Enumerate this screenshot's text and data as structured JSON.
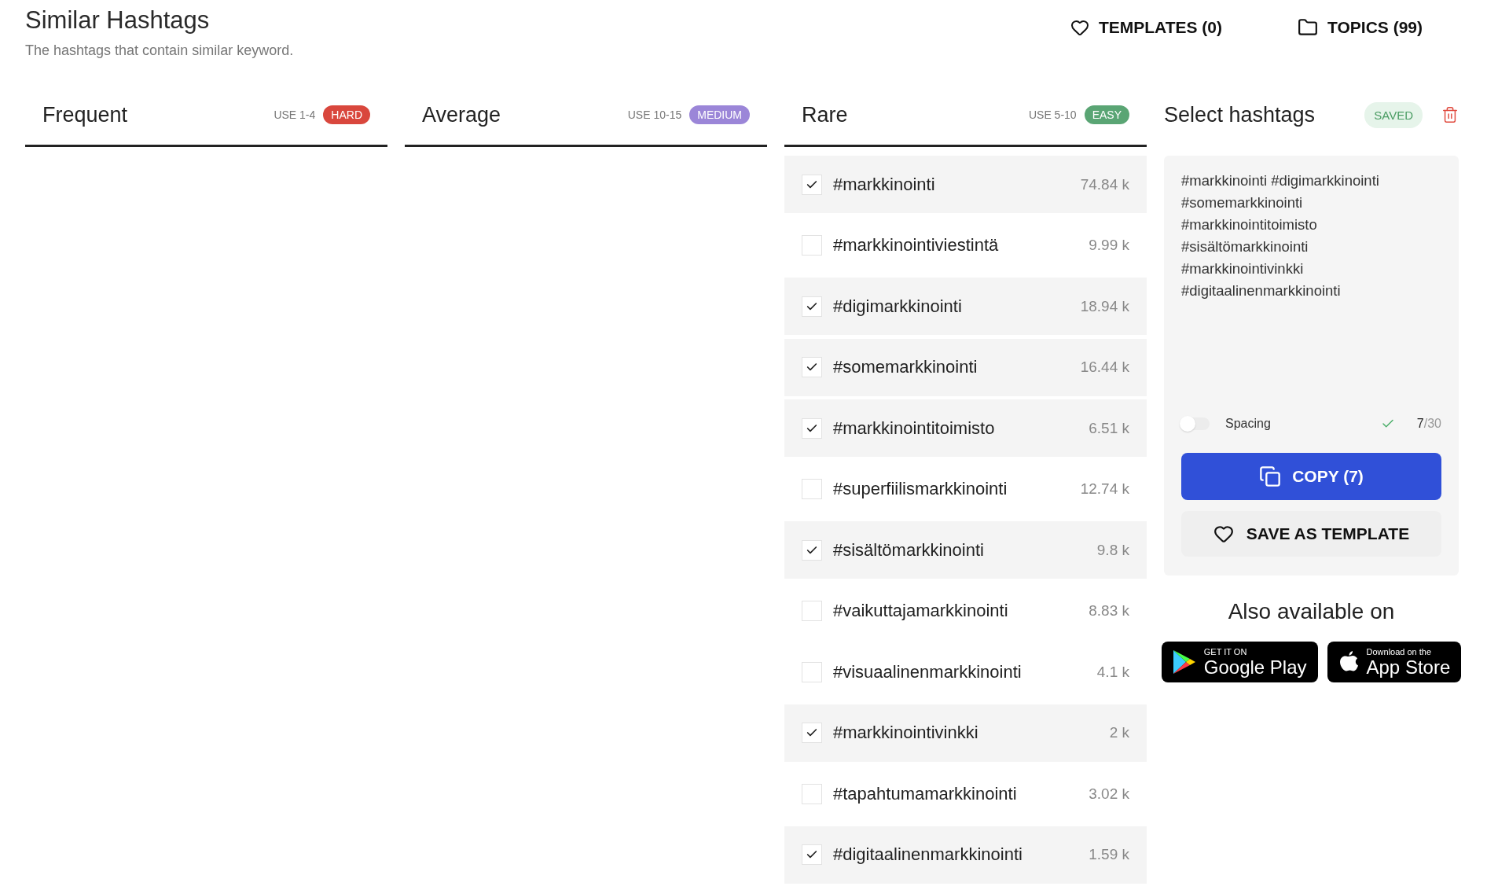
{
  "header": {
    "title": "Similar Hashtags",
    "subtitle": "The hashtags that contain similar keyword.",
    "actions": [
      {
        "kind": "heart",
        "label": "TEMPLATES (0)"
      },
      {
        "kind": "folder",
        "label": "TOPICS (99)"
      }
    ]
  },
  "columns": [
    {
      "title": "Frequent",
      "use": "USE 1-4",
      "badge": "HARD",
      "color": "#d9473d"
    },
    {
      "title": "Average",
      "use": "USE 10-15",
      "badge": "MEDIUM",
      "color": "#9b86d8"
    },
    {
      "title": "Rare",
      "use": "USE 5-10",
      "badge": "EASY",
      "color": "#5aa574",
      "hashtags": [
        {
          "tag": "#markkinointi",
          "count": "74.84 k",
          "checked": true
        },
        {
          "tag": "#markkinointiviestintä",
          "count": "9.99 k",
          "checked": false
        },
        {
          "tag": "#digimarkkinointi",
          "count": "18.94 k",
          "checked": true
        },
        {
          "tag": "#somemarkkinointi",
          "count": "16.44 k",
          "checked": true
        },
        {
          "tag": "#markkinointitoimisto",
          "count": "6.51 k",
          "checked": true
        },
        {
          "tag": "#superfiilismarkkinointi",
          "count": "12.74 k",
          "checked": false
        },
        {
          "tag": "#sisältömarkkinointi",
          "count": "9.8 k",
          "checked": true
        },
        {
          "tag": "#vaikuttajamarkkinointi",
          "count": "8.83 k",
          "checked": false
        },
        {
          "tag": "#visuaalinenmarkkinointi",
          "count": "4.1 k",
          "checked": false
        },
        {
          "tag": "#markkinointivinkki",
          "count": "2 k",
          "checked": true
        },
        {
          "tag": "#tapahtumamarkkinointi",
          "count": "3.02 k",
          "checked": false
        },
        {
          "tag": "#digitaalinenmarkkinointi",
          "count": "1.59 k",
          "checked": true
        }
      ]
    }
  ],
  "selection": {
    "title": "Select hashtags",
    "status": "SAVED",
    "text": "#markkinointi #digimarkkinointi #somemarkkinointi #markkinointitoimisto #sisältömarkkinointi #markkinointivinkki #digitaalinenmarkkinointi",
    "spacing": {
      "label": "Spacing",
      "on": false
    },
    "count": "7",
    "limit": "/30",
    "copy_button": "COPY (7)",
    "save_button": "SAVE AS TEMPLATE"
  },
  "stores": {
    "title": "Also available on",
    "badges": [
      {
        "kind": "google",
        "small": "GET IT ON",
        "big": "Google Play"
      },
      {
        "kind": "apple",
        "small": "Download on the",
        "big": "App Store"
      }
    ]
  }
}
